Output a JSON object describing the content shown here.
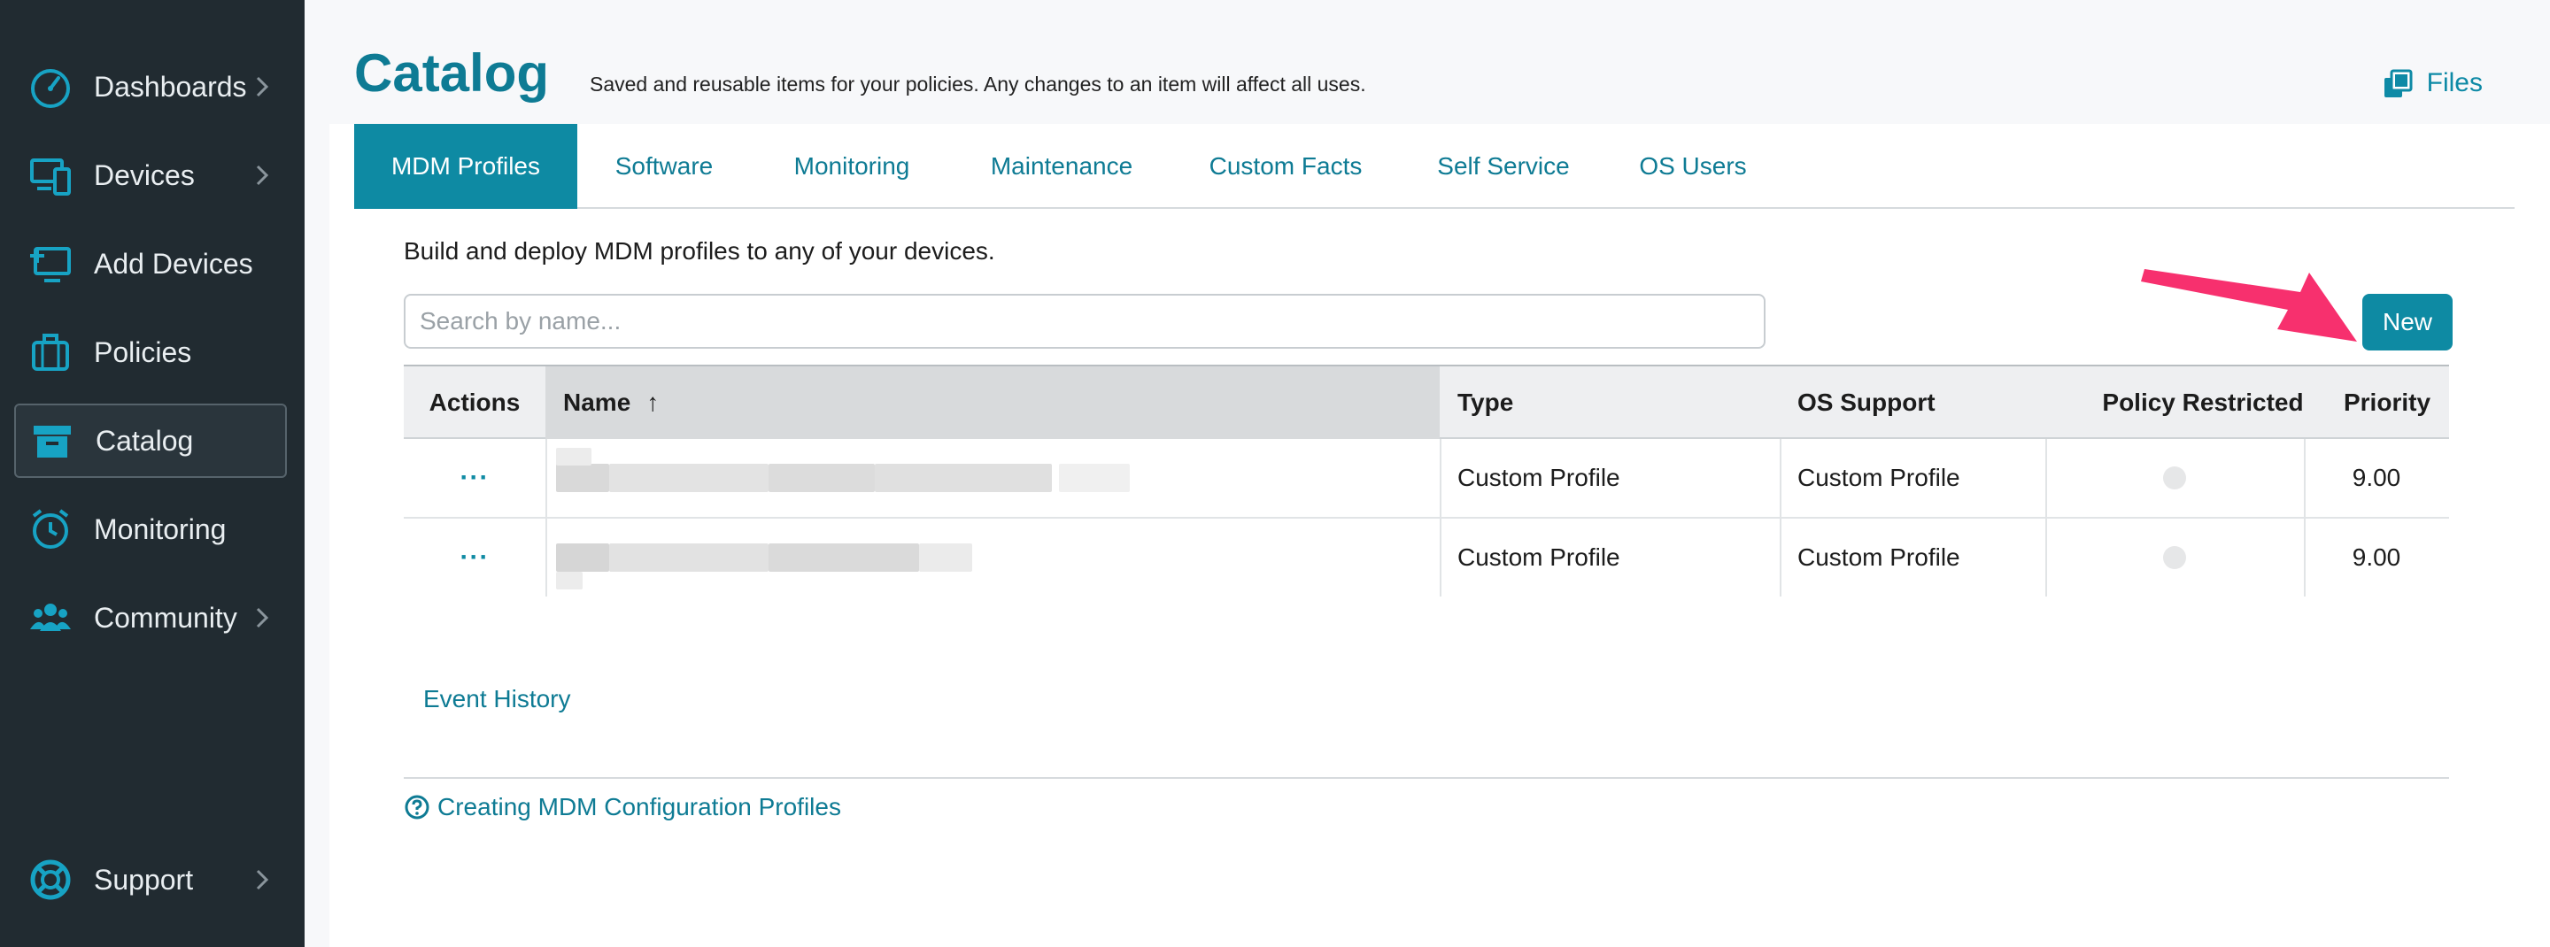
{
  "sidebar": {
    "items": [
      {
        "label": "Dashboards",
        "icon": "gauge-icon",
        "has_chevron": true
      },
      {
        "label": "Devices",
        "icon": "devices-icon",
        "has_chevron": true
      },
      {
        "label": "Add Devices",
        "icon": "add-device-icon",
        "has_chevron": false
      },
      {
        "label": "Policies",
        "icon": "briefcase-icon",
        "has_chevron": false
      },
      {
        "label": "Catalog",
        "icon": "archive-box-icon",
        "has_chevron": false,
        "active": true
      },
      {
        "label": "Monitoring",
        "icon": "alarm-clock-icon",
        "has_chevron": false
      },
      {
        "label": "Community",
        "icon": "people-icon",
        "has_chevron": true
      },
      {
        "label": "Support",
        "icon": "lifebuoy-icon",
        "has_chevron": true
      }
    ]
  },
  "header": {
    "title": "Catalog",
    "subtitle": "Saved and reusable items for your policies. Any changes to an item will affect all uses.",
    "files_label": "Files"
  },
  "tabs": [
    {
      "label": "MDM Profiles",
      "active": true
    },
    {
      "label": "Software"
    },
    {
      "label": "Monitoring"
    },
    {
      "label": "Maintenance"
    },
    {
      "label": "Custom Facts"
    },
    {
      "label": "Self Service"
    },
    {
      "label": "OS Users"
    }
  ],
  "content": {
    "intro": "Build and deploy MDM profiles to any of your devices.",
    "search_placeholder": "Search by name...",
    "new_button": "New",
    "event_history": "Event History",
    "help_link": "Creating MDM Configuration Profiles"
  },
  "table": {
    "columns": {
      "actions": "Actions",
      "name": "Name",
      "sort_indicator": "↑",
      "type": "Type",
      "os_support": "OS Support",
      "policy_restricted": "Policy Restricted",
      "priority": "Priority"
    },
    "rows": [
      {
        "actions": "···",
        "type": "Custom Profile",
        "os_support": "Custom Profile",
        "priority": "9.00"
      },
      {
        "actions": "···",
        "type": "Custom Profile",
        "os_support": "Custom Profile",
        "priority": "9.00"
      }
    ]
  },
  "colors": {
    "sidebar_bg": "#212b31",
    "accent": "#0e8aa3",
    "title": "#0e7b94",
    "arrow": "#f7306e"
  }
}
